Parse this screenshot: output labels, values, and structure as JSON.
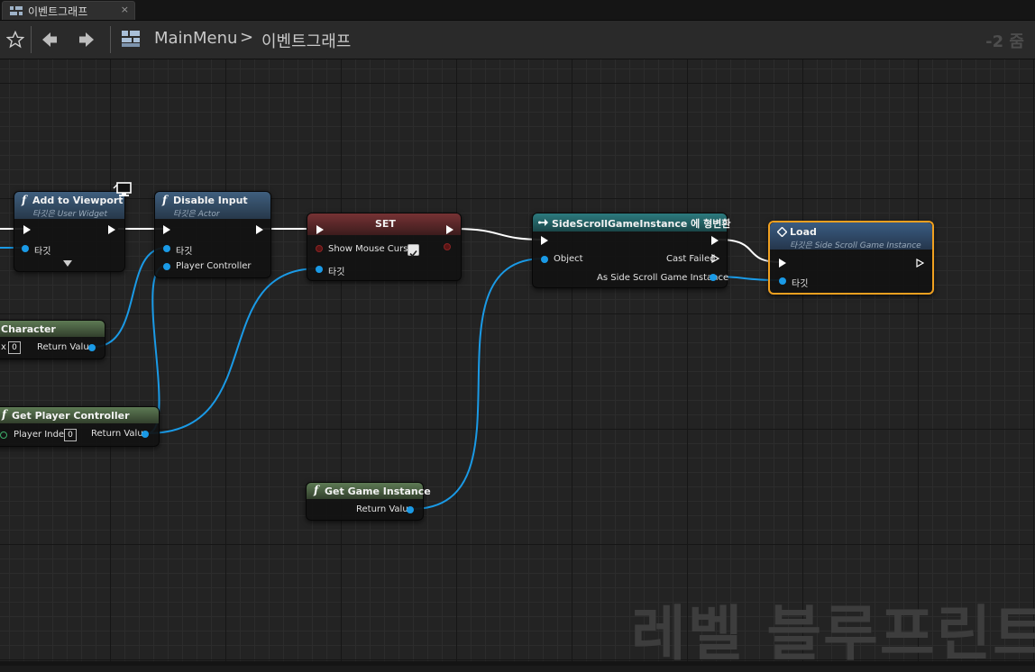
{
  "tab": {
    "label": "이벤트그래프",
    "icon": "event-graph-icon",
    "close": "×"
  },
  "toolbar": {
    "breadcrumb_root": "MainMenu",
    "breadcrumb_separator": ">",
    "breadcrumb_current": "이벤트그래프",
    "zoom": "-2 줌"
  },
  "nodes": {
    "add_to_viewport": {
      "title": "Add to Viewport",
      "subtitle": "타깃은 User Widget",
      "target_label": "타깃"
    },
    "disable_input": {
      "title": "Disable Input",
      "subtitle": "타깃은 Actor",
      "target_label": "타깃",
      "player_controller_label": "Player Controller"
    },
    "set": {
      "title": "SET",
      "show_mouse_cursor_label": "Show Mouse Cursor",
      "show_mouse_cursor_value": true,
      "target_label": "타깃"
    },
    "cast": {
      "title": "SideScrollGameInstance 에 형변환",
      "object_label": "Object",
      "cast_failed_label": "Cast Failed",
      "as_label": "As Side Scroll Game Instance"
    },
    "load": {
      "title": "Load",
      "subtitle": "타깃은 Side Scroll Game Instance",
      "target_label": "타깃"
    },
    "get_character": {
      "title": "Character",
      "index_fragment": "x",
      "index_value": "0",
      "return_label": "Return Value"
    },
    "get_player_controller": {
      "title": "Get Player Controller",
      "index_label": "Player Index",
      "index_value": "0",
      "return_label": "Return Value"
    },
    "get_game_instance": {
      "title": "Get Game Instance",
      "return_label": "Return Value"
    }
  },
  "function_glyph": "f",
  "watermark": "레벨 블루프린트",
  "colors": {
    "exec_wire": "#ffffff",
    "object_wire": "#1a9ae6",
    "selected_border": "#f0a020"
  }
}
